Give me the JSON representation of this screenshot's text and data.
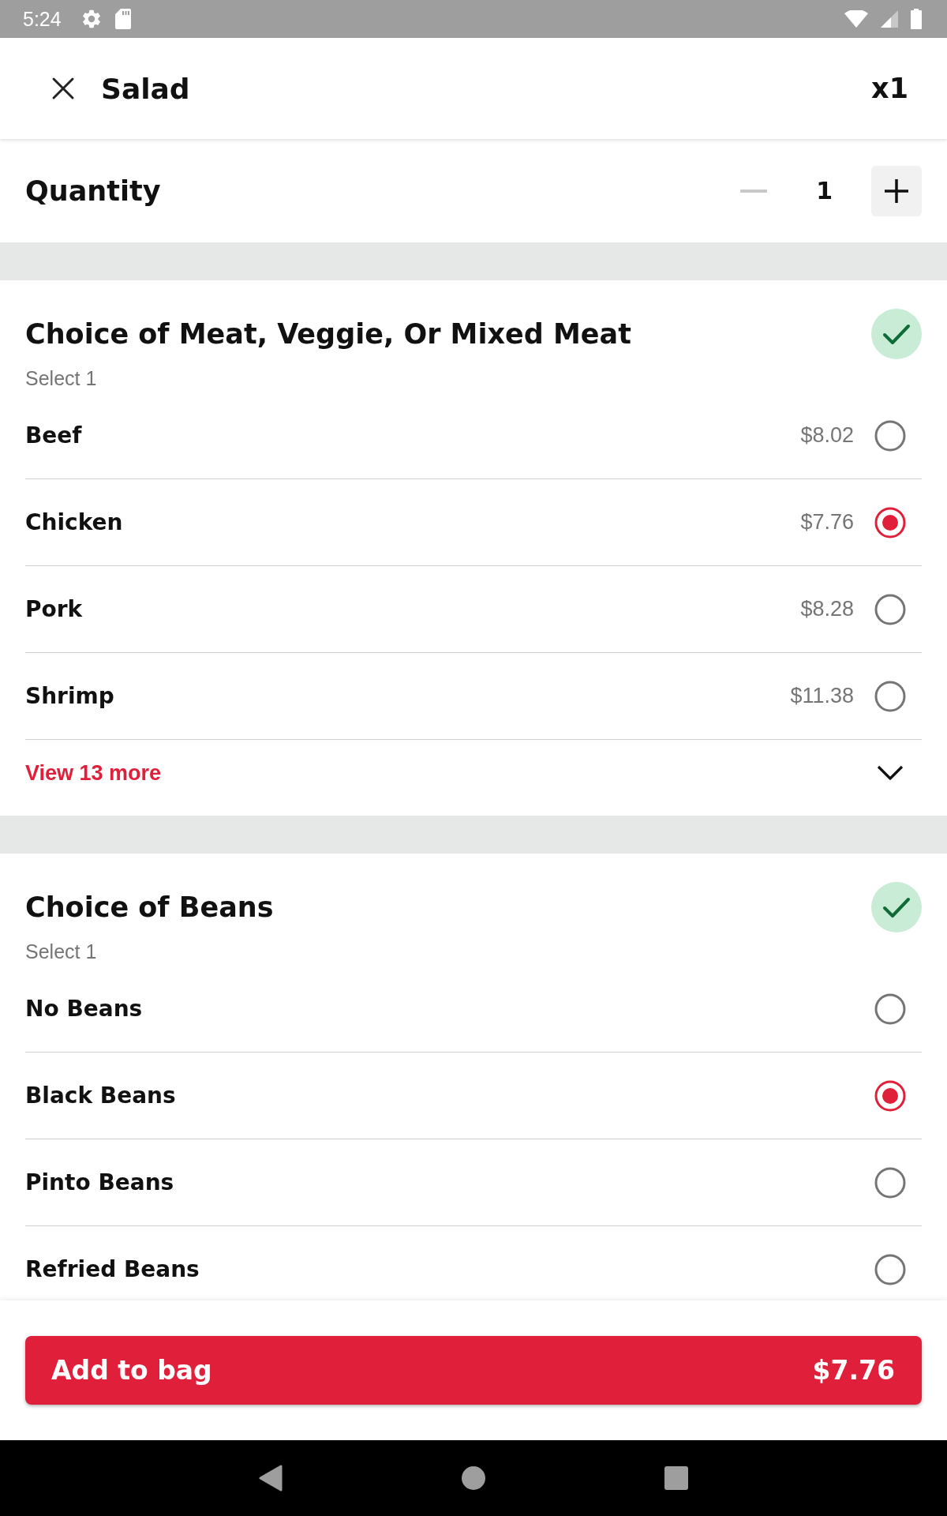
{
  "status_bar": {
    "time": "5:24"
  },
  "header": {
    "title": "Salad",
    "count": "x1"
  },
  "quantity": {
    "label": "Quantity",
    "value": "1",
    "decrement_disabled": true
  },
  "sections": [
    {
      "title": "Choice of Meat, Veggie, Or Mixed Meat",
      "complete": true,
      "hint": "Select 1",
      "options": [
        {
          "name": "Beef",
          "price": "$8.02",
          "selected": false
        },
        {
          "name": "Chicken",
          "price": "$7.76",
          "selected": true
        },
        {
          "name": "Pork",
          "price": "$8.28",
          "selected": false
        },
        {
          "name": "Shrimp",
          "price": "$11.38",
          "selected": false
        }
      ],
      "more": {
        "label": "View 13 more"
      }
    },
    {
      "title": "Choice of Beans",
      "complete": true,
      "hint": "Select 1",
      "options": [
        {
          "name": "No Beans",
          "selected": false
        },
        {
          "name": "Black Beans",
          "selected": true
        },
        {
          "name": "Pinto Beans",
          "selected": false
        },
        {
          "name": "Refried Beans",
          "selected": false
        }
      ]
    }
  ],
  "footer": {
    "add_button": {
      "label": "Add to bag",
      "price": "$7.76"
    }
  }
}
